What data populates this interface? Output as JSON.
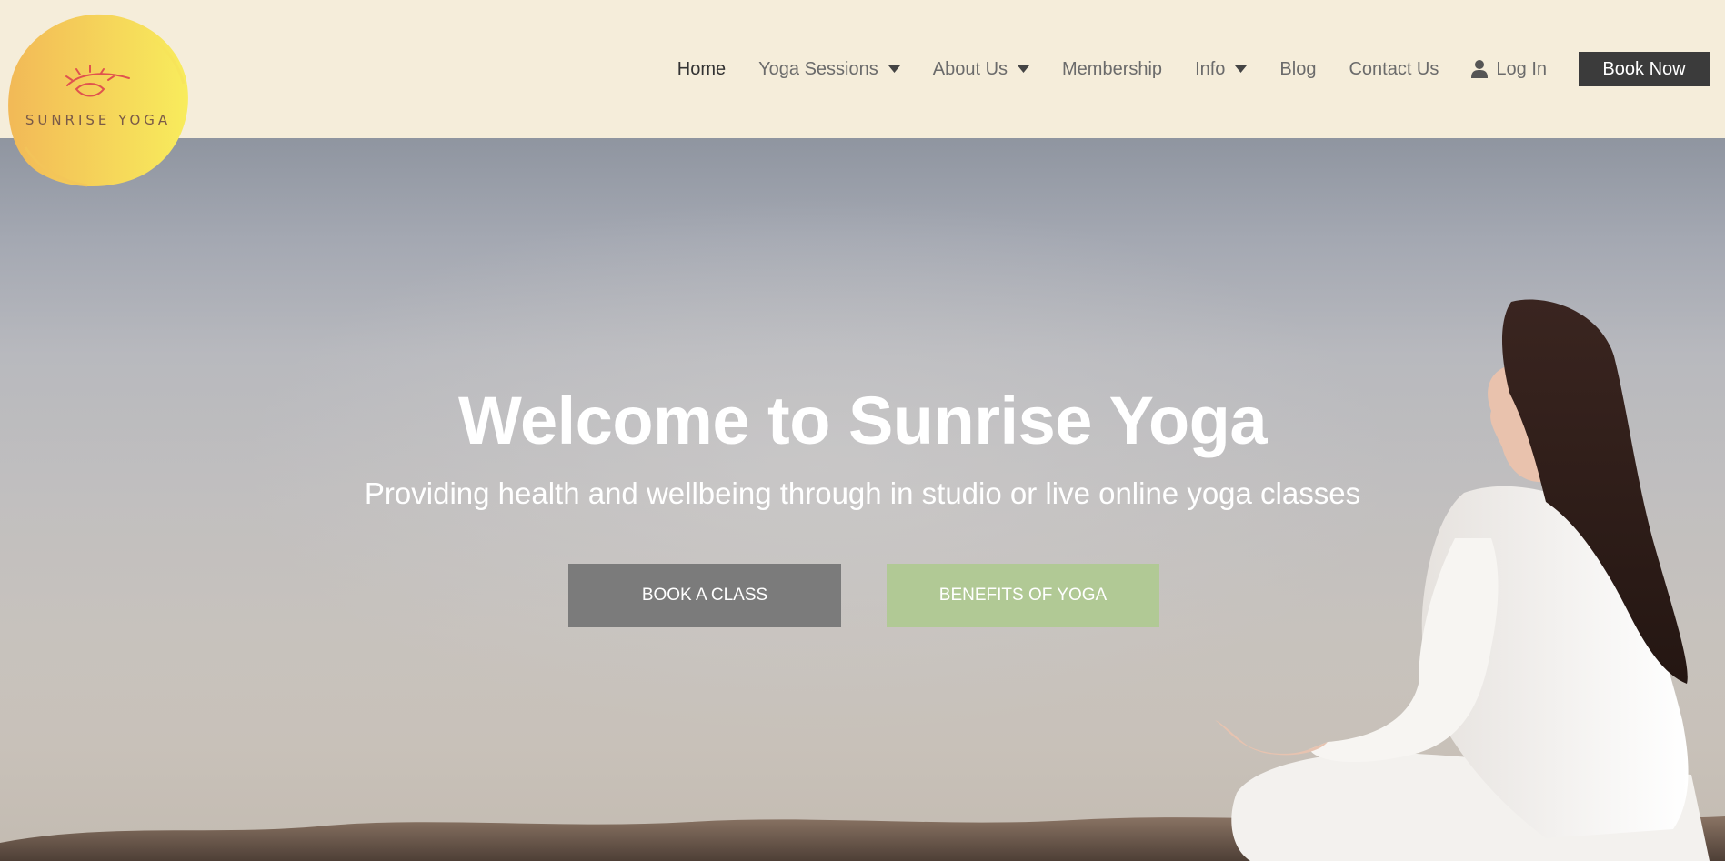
{
  "brand": {
    "name": "SUNRISE YOGA",
    "logo_color_start": "#f2b957",
    "logo_color_end": "#f8ec5c"
  },
  "nav": {
    "items": [
      {
        "label": "Home",
        "icon": "",
        "active": true
      },
      {
        "label": "Yoga Sessions",
        "icon": "caret-down-icon"
      },
      {
        "label": "About Us",
        "icon": "caret-down-icon"
      },
      {
        "label": "Membership",
        "icon": ""
      },
      {
        "label": "Info",
        "icon": "caret-down-icon"
      },
      {
        "label": "Blog",
        "icon": ""
      },
      {
        "label": "Contact Us",
        "icon": ""
      },
      {
        "label": "Log In",
        "icon": "user-icon"
      }
    ],
    "cta_label": "Book Now",
    "cta_color": "#3b3b3b"
  },
  "hero": {
    "title": "Welcome to Sunrise Yoga",
    "subtitle": "Providing health and wellbeing through in studio or live online yoga classes",
    "primary_button": "BOOK A CLASS",
    "secondary_button": "BENEFITS OF YOGA",
    "primary_color": "#7b7b7b",
    "secondary_color": "#b1c995"
  },
  "colors": {
    "header_bg": "#f5edda",
    "nav_text": "#6b6b6b"
  }
}
